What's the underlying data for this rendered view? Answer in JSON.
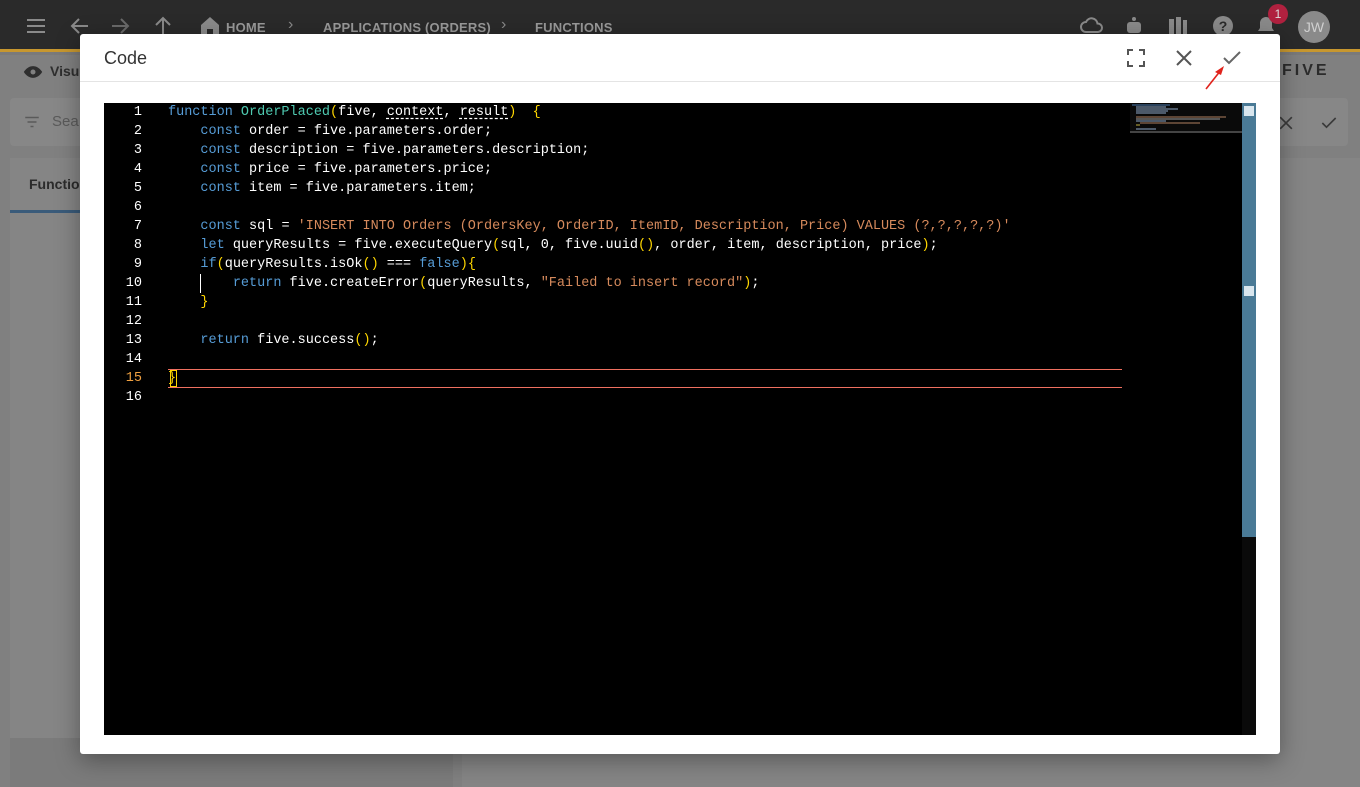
{
  "topbar": {
    "breadcrumbs": [
      "HOME",
      "APPLICATIONS (ORDERS)",
      "FUNCTIONS"
    ],
    "notification_count": "1",
    "avatar_initials": "JW"
  },
  "background": {
    "visual_label": "Visu",
    "brand": "FIVE",
    "search_placeholder": "Sea",
    "tab_label": "Function"
  },
  "modal": {
    "title": "Code",
    "buttons": [
      "fullscreen-icon",
      "close-icon",
      "check-icon"
    ]
  },
  "editor": {
    "line_numbers": [
      "1",
      "2",
      "3",
      "4",
      "5",
      "6",
      "7",
      "8",
      "9",
      "10",
      "11",
      "12",
      "13",
      "14",
      "15",
      "16"
    ],
    "active_line": 15,
    "lines": [
      "function OrderPlaced(five, context, result)  {",
      "    const order = five.parameters.order;",
      "    const description = five.parameters.description;",
      "    const price = five.parameters.price;",
      "    const item = five.parameters.item;",
      "",
      "    const sql = 'INSERT INTO Orders (OrdersKey, OrderID, ItemID, Description, Price) VALUES (?,?,?,?,?)'",
      "    let queryResults = five.executeQuery(sql, 0, five.uuid(), order, item, description, price);",
      "    if(queryResults.isOk() === false){",
      "        return five.createError(queryResults, \"Failed to insert record\");",
      "    }",
      "",
      "    return five.success();",
      "",
      "}",
      ""
    ]
  },
  "colors": {
    "keyword": "#569cd6",
    "function_name": "#4ec9b0",
    "string": "#d68a5c",
    "bracket": "#ffd700",
    "topbar_accent": "#c7972f",
    "scrollbar": "#4a7a96",
    "annotation_arrow": "#e0231c"
  }
}
